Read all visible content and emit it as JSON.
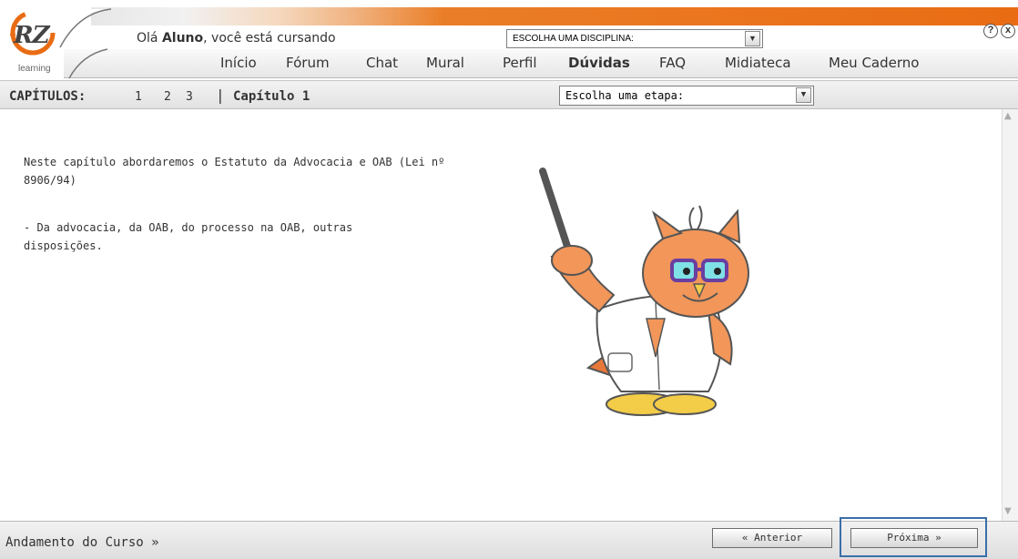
{
  "brand": {
    "logo": "RZ",
    "logo_sub": "learning"
  },
  "header": {
    "greeting_prefix": "Olá ",
    "greeting_name": "Aluno",
    "greeting_suffix": ", você está cursando",
    "discipline_select": "ESCOLHA UMA DISCIPLINA:",
    "help_icon": "?",
    "close_icon": "x"
  },
  "nav": {
    "inicio": "Início",
    "forum": "Fórum",
    "chat": "Chat",
    "mural": "Mural",
    "perfil": "Perfil",
    "duvidas": "Dúvidas",
    "faq": "FAQ",
    "midiateca": "Midiateca",
    "caderno": "Meu Caderno"
  },
  "chapters": {
    "label": "CAPÍTULOS:",
    "items": [
      "1",
      "2",
      "3"
    ],
    "separator": "|",
    "current": "Capítulo 1",
    "stage_select": "Escolha uma etapa:"
  },
  "content": {
    "intro": "Neste capítulo abordaremos o Estatuto da Advocacia e OAB (Lei nº 8906/94)",
    "detail": "- Da advocacia, da OAB, do processo na OAB, outras disposições."
  },
  "footer": {
    "progress": "Andamento do Curso »",
    "prev": "« Anterior",
    "next": "Próxima »"
  },
  "colors": {
    "accent": "#e96c14",
    "highlight": "#3a6fa8",
    "mascot_body": "#f2965a"
  }
}
